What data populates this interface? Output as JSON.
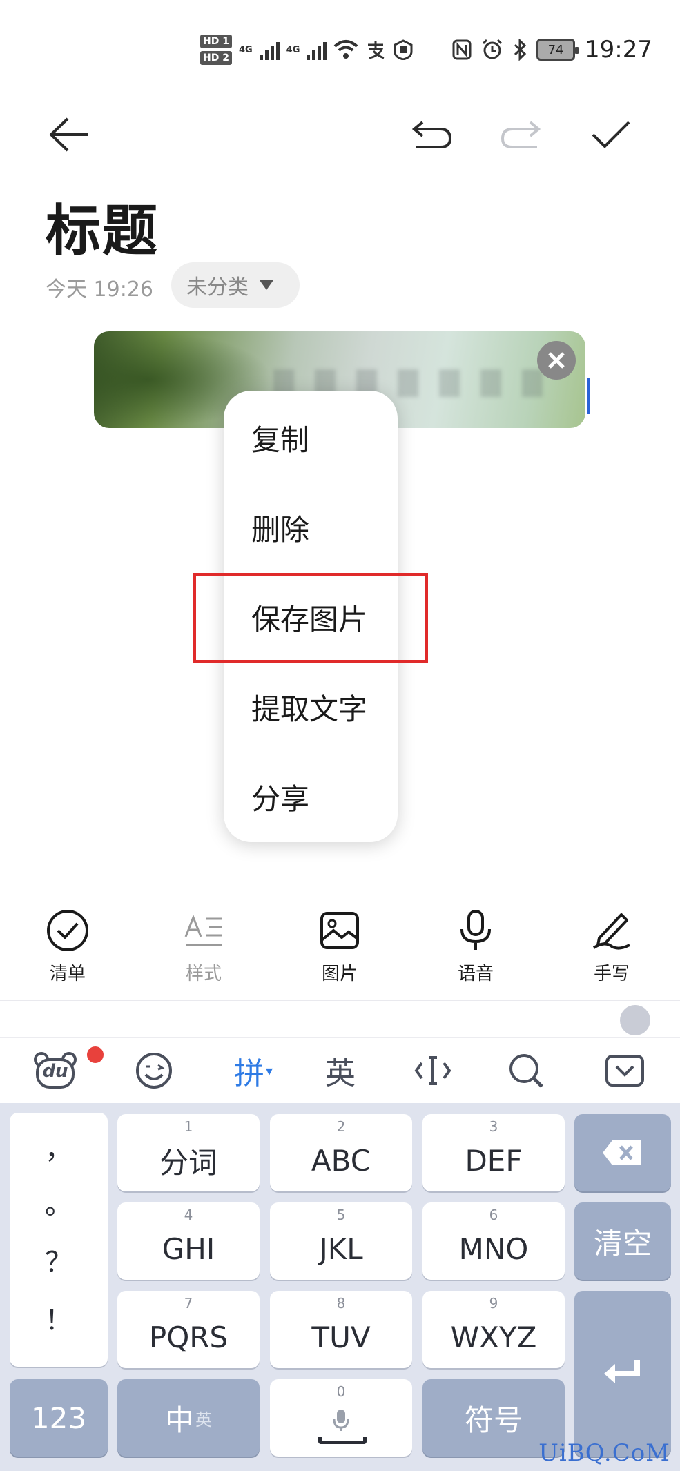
{
  "status_bar": {
    "hd1": "HD 1",
    "hd2": "HD 2",
    "net1": "4G",
    "net2": "4G",
    "battery": "74",
    "time": "19:27"
  },
  "note": {
    "title": "标题",
    "date": "今天 19:26",
    "category": "未分类"
  },
  "context_menu": {
    "items": [
      "复制",
      "删除",
      "保存图片",
      "提取文字",
      "分享"
    ]
  },
  "edit_toolbar": {
    "items": [
      "清单",
      "样式",
      "图片",
      "语音",
      "手写"
    ]
  },
  "ime_toolbar": {
    "du_label": "du",
    "pinyin": "拼",
    "english": "英"
  },
  "keyboard": {
    "punct": [
      "，",
      "。",
      "？",
      "！"
    ],
    "keys": [
      {
        "num": "1",
        "label": "分词"
      },
      {
        "num": "2",
        "label": "ABC"
      },
      {
        "num": "3",
        "label": "DEF"
      },
      {
        "num": "4",
        "label": "GHI"
      },
      {
        "num": "5",
        "label": "JKL"
      },
      {
        "num": "6",
        "label": "MNO"
      },
      {
        "num": "7",
        "label": "PQRS"
      },
      {
        "num": "8",
        "label": "TUV"
      },
      {
        "num": "9",
        "label": "WXYZ"
      }
    ],
    "clear": "清空",
    "num_mode": "123",
    "lang_zh": "中",
    "lang_en": "英",
    "space_num": "0",
    "symbols": "符号"
  },
  "watermark": "UiBQ.CoM",
  "colors": {
    "accent": "#2f7be5",
    "highlight": "#e02a2a",
    "func_key": "#9fadc7",
    "keyboard_bg": "#dfe3ee"
  }
}
